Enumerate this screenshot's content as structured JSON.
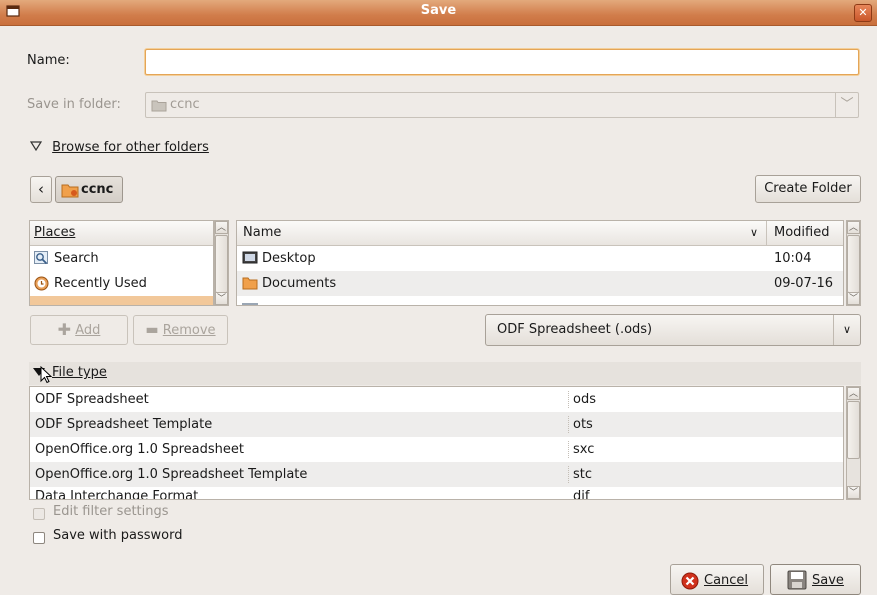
{
  "window": {
    "title": "Save"
  },
  "name_field": {
    "label": "Name:",
    "value": ""
  },
  "save_in": {
    "label": "Save in folder:",
    "value": "ccnc"
  },
  "browse": {
    "label": "Browse for other folders"
  },
  "path_bar": {
    "back": "‹",
    "current": "ccnc",
    "create_folder": "Create Folder"
  },
  "places": {
    "header": "Places",
    "items": [
      {
        "label": "Search",
        "icon": "search-icon"
      },
      {
        "label": "Recently Used",
        "icon": "recent-icon"
      }
    ]
  },
  "files": {
    "col_name": "Name",
    "col_modified": "Modified",
    "rows": [
      {
        "name": "Desktop",
        "modified": "10:04",
        "icon": "desktop-icon"
      },
      {
        "name": "Documents",
        "modified": "09-07-16",
        "icon": "folder-icon"
      }
    ]
  },
  "place_buttons": {
    "add": "Add",
    "remove": "Remove"
  },
  "filter_combo": {
    "value": "ODF Spreadsheet (.ods)"
  },
  "file_type": {
    "label": "File type",
    "rows": [
      {
        "name": "ODF Spreadsheet",
        "ext": "ods"
      },
      {
        "name": "ODF Spreadsheet Template",
        "ext": "ots"
      },
      {
        "name": "OpenOffice.org 1.0 Spreadsheet",
        "ext": "sxc"
      },
      {
        "name": "OpenOffice.org 1.0 Spreadsheet Template",
        "ext": "stc"
      },
      {
        "name": "Data Interchange Format",
        "ext": "dif"
      }
    ]
  },
  "options": {
    "edit_filter": "Edit filter settings",
    "password": "Save with password"
  },
  "actions": {
    "cancel": "Cancel",
    "save": "Save"
  },
  "colors": {
    "accent": "#d17d4b",
    "focus": "#e4a557",
    "background": "#efebe7"
  }
}
